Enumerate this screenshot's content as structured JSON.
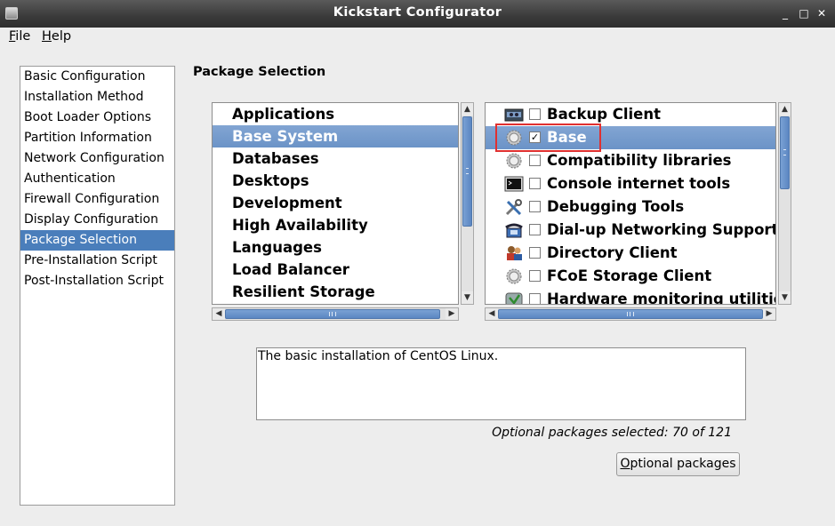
{
  "window": {
    "title": "Kickstart Configurator",
    "controls": [
      "_",
      "□",
      "✕"
    ]
  },
  "menubar": {
    "file": {
      "mnemonic": "F",
      "rest": "ile"
    },
    "help": {
      "mnemonic": "H",
      "rest": "elp"
    }
  },
  "nav": {
    "items": [
      {
        "label": "Basic Configuration"
      },
      {
        "label": "Installation Method"
      },
      {
        "label": "Boot Loader Options"
      },
      {
        "label": "Partition Information"
      },
      {
        "label": "Network Configuration"
      },
      {
        "label": "Authentication"
      },
      {
        "label": "Firewall Configuration"
      },
      {
        "label": "Display Configuration"
      },
      {
        "label": "Package Selection"
      },
      {
        "label": "Pre-Installation Script"
      },
      {
        "label": "Post-Installation Script"
      }
    ],
    "selected_label": "Package Selection"
  },
  "section_title": "Package Selection",
  "groups": {
    "items": [
      {
        "label": "Applications"
      },
      {
        "label": "Base System"
      },
      {
        "label": "Databases"
      },
      {
        "label": "Desktops"
      },
      {
        "label": "Development"
      },
      {
        "label": "High Availability"
      },
      {
        "label": "Languages"
      },
      {
        "label": "Load Balancer"
      },
      {
        "label": "Resilient Storage"
      }
    ],
    "selected_label": "Base System"
  },
  "packages": {
    "items": [
      {
        "label": "Backup Client",
        "checked": false,
        "icon": "tape-drive-icon"
      },
      {
        "label": "Base",
        "checked": true,
        "icon": "gear-icon"
      },
      {
        "label": "Compatibility libraries",
        "checked": false,
        "icon": "gear-icon"
      },
      {
        "label": "Console internet tools",
        "checked": false,
        "icon": "terminal-icon"
      },
      {
        "label": "Debugging Tools",
        "checked": false,
        "icon": "tools-icon"
      },
      {
        "label": "Dial-up Networking Support",
        "checked": false,
        "icon": "phone-icon"
      },
      {
        "label": "Directory Client",
        "checked": false,
        "icon": "users-icon"
      },
      {
        "label": "FCoE Storage Client",
        "checked": false,
        "icon": "gear-icon"
      },
      {
        "label": "Hardware monitoring utilitie",
        "checked": false,
        "icon": "monitor-icon"
      }
    ],
    "selected_label": "Base"
  },
  "description": "The basic installation of CentOS Linux.",
  "status_text": "Optional packages selected: 70 of 121",
  "optional_button": {
    "mnemonic": "O",
    "rest": "ptional packages"
  },
  "colors": {
    "selection": "#4a7ebb",
    "highlight_box": "#e03030",
    "titlebar": "#3a3a3a"
  }
}
